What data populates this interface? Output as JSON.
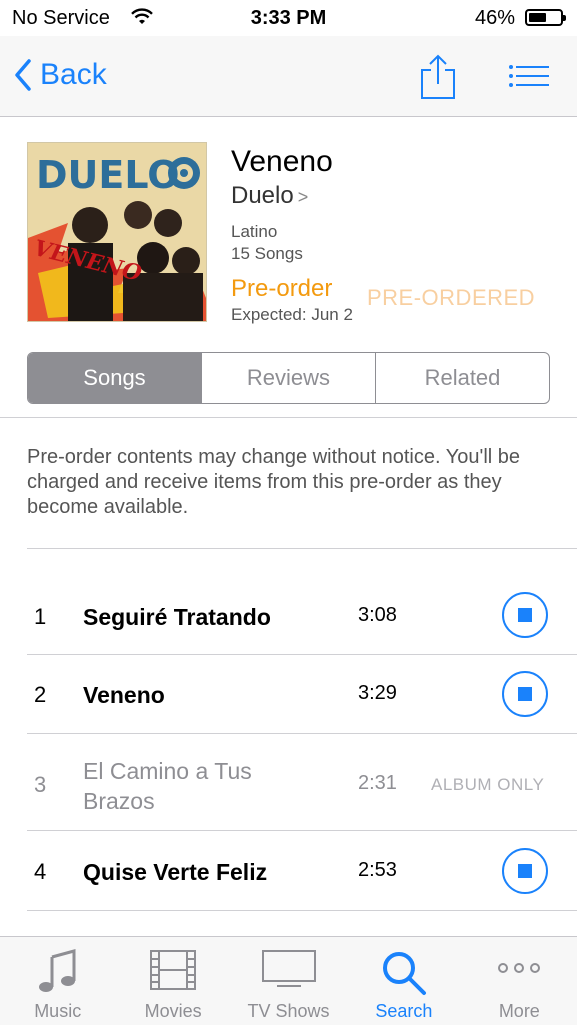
{
  "status": {
    "carrier": "No Service",
    "time": "3:33 PM",
    "battery": "46%"
  },
  "nav": {
    "back_label": "Back"
  },
  "album": {
    "cover_text": "DUELO",
    "cover_subtitle": "VENENO",
    "title": "Veneno",
    "artist": "Duelo",
    "genre": "Latino",
    "song_count": "15 Songs",
    "preorder_label": "Pre-order",
    "preordered_watermark": "PRE-ORDERED",
    "expected": "Expected: Jun 2"
  },
  "segments": [
    "Songs",
    "Reviews",
    "Related"
  ],
  "notice": "Pre-order contents may change without notice. You'll be charged and receive items from this pre-order as they become available.",
  "tracks": [
    {
      "num": "1",
      "name": "Seguiré Tratando",
      "duration": "3:08"
    },
    {
      "num": "2",
      "name": "Veneno",
      "duration": "3:29"
    },
    {
      "num": "3",
      "name": "El Camino a Tus Brazos",
      "duration": "2:31",
      "note": "ALBUM ONLY"
    },
    {
      "num": "4",
      "name": "Quise Verte Feliz",
      "duration": "2:53"
    }
  ],
  "tabs": [
    {
      "label": "Music",
      "icon": "music-icon"
    },
    {
      "label": "Movies",
      "icon": "film-icon"
    },
    {
      "label": "TV Shows",
      "icon": "tv-icon"
    },
    {
      "label": "Search",
      "icon": "search-icon"
    },
    {
      "label": "More",
      "icon": "more-icon"
    }
  ],
  "colors": {
    "accent": "#1a82fb",
    "preorder": "#f39a0f"
  }
}
